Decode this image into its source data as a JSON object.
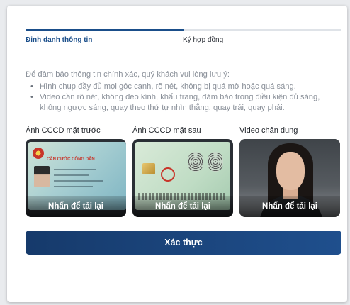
{
  "stepper": {
    "steps": [
      {
        "label": "Định danh thông tin",
        "active": true
      },
      {
        "label": "Ký hợp đồng",
        "active": false
      }
    ],
    "progress": 0.5
  },
  "instructions": {
    "intro": "Để đảm bảo thông tin chính xác, quý khách vui lòng lưu ý:",
    "items": [
      "Hình chụp đầy đủ mọi góc cạnh, rõ nét, không bị quá mờ hoặc quá sáng.",
      "Video cần rõ nét, không đeo kính, khẩu trang, đảm bảo trong điều kiện đủ sáng, không ngược sáng, quay theo thứ tự nhìn thẳng, quay trái, quay phải."
    ]
  },
  "documents": [
    {
      "title": "Ảnh CCCD mặt trước",
      "reload_label": "Nhấn để tải lại"
    },
    {
      "title": "Ảnh CCCD mặt sau",
      "reload_label": "Nhấn để tải lại"
    },
    {
      "title": "Video chân dung",
      "reload_label": "Nhấn để tải lại"
    }
  ],
  "id_front_text": "CĂN CƯỚC CÔNG DÂN",
  "verify_button": "Xác thực",
  "colors": {
    "primary": "#1a4e8a",
    "button": "#163a6b",
    "text_muted": "#8a9099"
  }
}
